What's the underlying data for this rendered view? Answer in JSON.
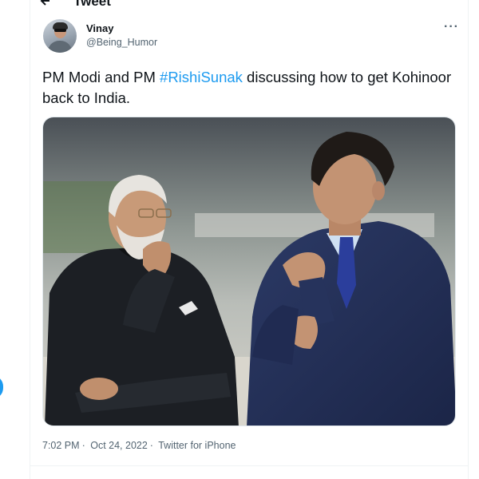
{
  "header": {
    "title": "Tweet"
  },
  "author": {
    "display_name": "Vinay",
    "handle": "@Being_Humor"
  },
  "tweet": {
    "text_before": "PM Modi and PM ",
    "hashtag": "#RishiSunak",
    "text_after": " discussing how to get Kohinoor back to India."
  },
  "meta": {
    "time": "7:02 PM",
    "separator": "·",
    "date": "Oct 24, 2022",
    "source": "Twitter for iPhone"
  },
  "colors": {
    "accent": "#1d9bf0",
    "text": "#0f1419",
    "secondary": "#536471"
  }
}
